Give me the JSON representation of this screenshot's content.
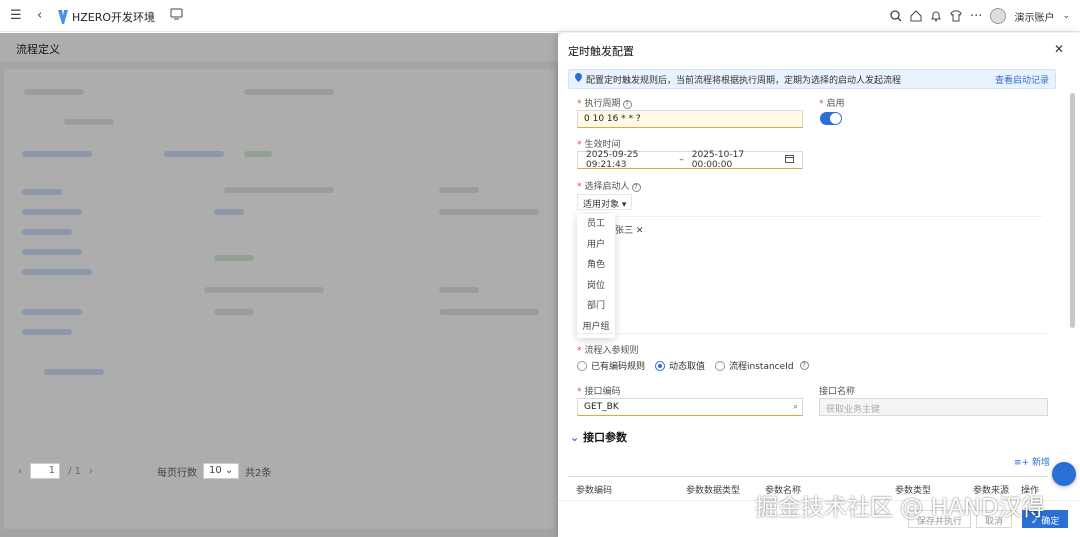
{
  "topbar": {
    "app_title": "HZERO开发环境",
    "account_name": "演示账户"
  },
  "background_page": {
    "title": "流程定义",
    "pagination": {
      "current_page": "1",
      "total_pages": "/ 1",
      "page_size_label": "每页行数",
      "page_size": "10",
      "total_label": "共2条"
    }
  },
  "drawer": {
    "title": "定时触发配置",
    "info_text": "配置定时触发规则后，当前流程将根据执行周期，定期为选择的启动人发起流程",
    "info_link": "查看启动记录",
    "cycle": {
      "label": "执行周期",
      "value": "0 10 16 * * ?"
    },
    "enabled": {
      "label": "启用",
      "value": true
    },
    "effective_time": {
      "label": "生效时间",
      "start": "2025-09-25 09:21:43",
      "separator": "–",
      "end": "2025-10-17 00:00:00"
    },
    "initiator": {
      "label": "选择启动人",
      "select_label": "适用对象",
      "options": [
        "员工",
        "用户",
        "角色",
        "岗位",
        "部门",
        "用户组"
      ],
      "selected_tag": "张三"
    },
    "param_rule": {
      "label": "流程入参规则",
      "options": [
        "已有编码规则",
        "动态取值",
        "流程instanceId"
      ],
      "selected_index": 1
    },
    "api_code": {
      "label": "接口编码",
      "value": "GET_BK"
    },
    "api_name": {
      "label": "接口名称",
      "placeholder": "获取业务主键"
    },
    "params_section": {
      "title": "接口参数",
      "add_label": "新增",
      "columns": [
        "参数编码",
        "参数数据类型",
        "参数名称",
        "参数类型",
        "参数来源",
        "操作"
      ]
    },
    "footer": {
      "save_execute": "保存并执行",
      "cancel": "取消",
      "confirm": "确定"
    }
  },
  "watermark": "掘金技术社区 @ HAND汉得",
  "colors": {
    "primary": "#2b6fd6",
    "required": "#e54545",
    "info_bg": "#eaf3fd"
  }
}
